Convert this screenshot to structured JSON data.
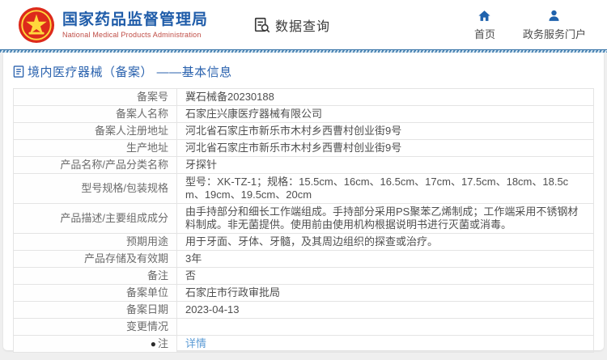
{
  "header": {
    "org_name": "国家药品监督管理局",
    "org_name_en": "National Medical Products Administration",
    "data_query_label": "数据查询",
    "nav": [
      {
        "label": "首页",
        "icon": "home-icon"
      },
      {
        "label": "政务服务门户",
        "icon": "user-icon"
      }
    ]
  },
  "page": {
    "section_title": "境内医疗器械（备案） ——基本信息"
  },
  "table": {
    "rows": [
      {
        "label": "备案号",
        "value": "冀石械备20230188"
      },
      {
        "label": "备案人名称",
        "value": "石家庄兴康医疗器械有限公司"
      },
      {
        "label": "备案人注册地址",
        "value": "河北省石家庄市新乐市木村乡西曹村创业街9号"
      },
      {
        "label": "生产地址",
        "value": "河北省石家庄市新乐市木村乡西曹村创业街9号"
      },
      {
        "label": "产品名称/产品分类名称",
        "value": "牙探针"
      },
      {
        "label": "型号规格/包装规格",
        "value": "型号：XK-TZ-1；规格：15.5cm、16cm、16.5cm、17cm、17.5cm、18cm、18.5cm、19cm、19.5cm、20cm"
      },
      {
        "label": "产品描述/主要组成成分",
        "value": "由手持部分和细长工作端组成。手持部分采用PS聚苯乙烯制成；工作端采用不锈钢材料制成。非无菌提供。使用前由使用机构根据说明书进行灭菌或消毒。"
      },
      {
        "label": "预期用途",
        "value": "用于牙面、牙体、牙髓，及其周边组织的探查或治疗。"
      },
      {
        "label": "产品存储及有效期",
        "value": "3年"
      },
      {
        "label": "备注",
        "value": "否"
      },
      {
        "label": "备案单位",
        "value": "石家庄市行政审批局"
      },
      {
        "label": "备案日期",
        "value": "2023-04-13"
      },
      {
        "label": "变更情况",
        "value": ""
      },
      {
        "label": "注",
        "value": "详情",
        "link": true,
        "icon": "note-icon"
      }
    ]
  },
  "colors": {
    "brand_blue": "#1f5ca9",
    "title_blue": "#2a62ae",
    "link_blue": "#5b9bd5",
    "subtitle_red": "#bf4b44",
    "emblem_red": "#dd2a1b",
    "emblem_gold": "#ffd83c",
    "border_gray": "#e4e4e4"
  }
}
